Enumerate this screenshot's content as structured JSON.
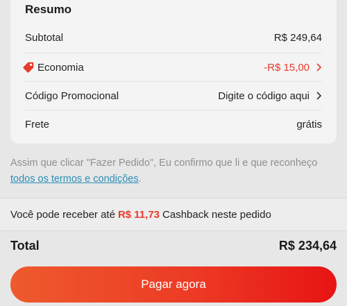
{
  "summary": {
    "title": "Resumo",
    "subtotal": {
      "label": "Subtotal",
      "value": "R$ 249,64"
    },
    "economia": {
      "label": "Economia",
      "value": "-R$ 15,00",
      "icon": "tag-icon",
      "value_color": "#e83b2e"
    },
    "promo": {
      "label": "Código Promocional",
      "value": "Digite o código aqui"
    },
    "frete": {
      "label": "Frete",
      "value": "grátis"
    }
  },
  "disclaimer": {
    "text": "Assim que clicar \"Fazer Pedido\", Eu confirmo que li e que reconheço ",
    "link": "todos os termos e condições",
    "suffix": "."
  },
  "cashback": {
    "prefix": "Você pode receber até",
    "amount": "R$ 11,73",
    "suffix": "Cashback neste pedido"
  },
  "total": {
    "label": "Total",
    "value": "R$ 234,64"
  },
  "pay_button": {
    "label": "Pagar agora"
  },
  "colors": {
    "accent": "#e83b2e",
    "link": "#2b8db6"
  }
}
